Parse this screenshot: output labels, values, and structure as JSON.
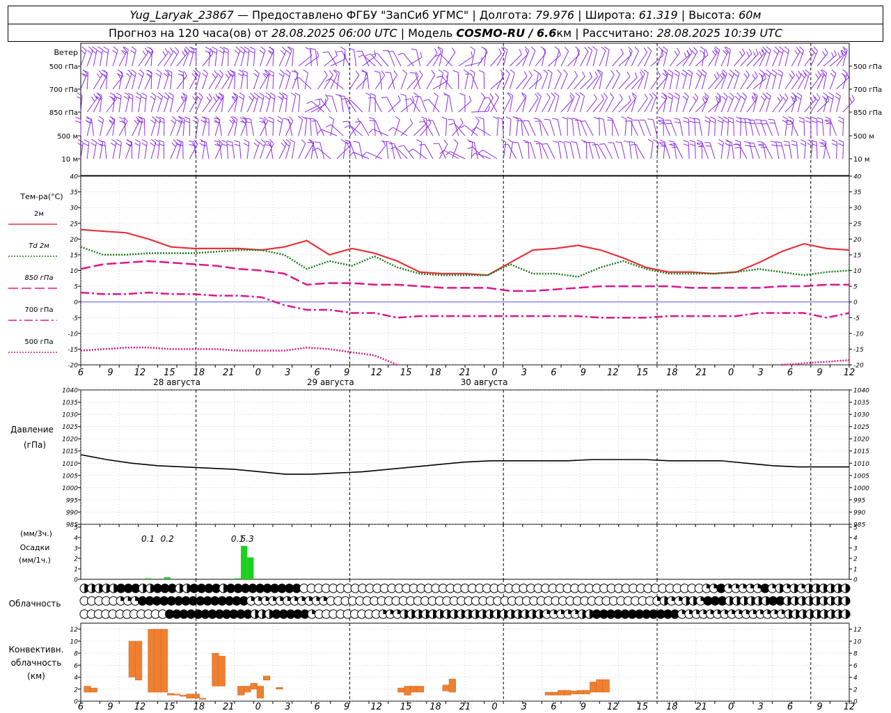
{
  "header": {
    "station": "Yug_Laryak_23867",
    "provider": " — Предоставлено ФГБУ \"ЗапСиб УГМС\" | Долгота: ",
    "lon": "79.976",
    "lat_label": " | Широта: ",
    "lat": "61.319",
    "alt_label": " | Высота: ",
    "alt": "60м",
    "forecast_label": "Прогноз на 120 часа(ов) от ",
    "forecast_time": "28.08.2025 06:00 UTC",
    "model_label": " | Модель ",
    "model": "COSMO-RU / 6.6",
    "model_unit": "км | Рассчитано: ",
    "calc_time": "28.08.2025 10:39 UTC"
  },
  "colors": {
    "wind": "#8a2be2",
    "t2m": "#e8333a",
    "td2m": "#1a7a1a",
    "t850": "#e0148a",
    "t700": "#e0148a",
    "t500": "#e0148a",
    "zero_line": "#3a3aff",
    "precip": "#1ed11e",
    "convective": "#f08030",
    "grid": "#000000"
  },
  "chart_data": [
    {
      "type": "barbs",
      "title": "Ветер",
      "levels": [
        "500 гПа",
        "700 гПа",
        "850 гПа",
        "500 м",
        "10  м"
      ]
    },
    {
      "type": "line",
      "ylabel": "Тем-ра(°C)",
      "ylim": [
        -20,
        40
      ],
      "yticks": [
        40,
        35,
        30,
        25,
        20,
        15,
        10,
        5,
        0,
        -5,
        -10,
        -15,
        -20
      ],
      "x_hours": [
        0,
        3,
        6,
        9,
        12,
        15,
        18,
        21,
        24,
        27,
        30,
        33,
        36,
        39,
        42,
        45,
        48,
        51,
        54,
        57,
        60,
        63,
        66,
        69,
        72,
        75,
        78,
        81,
        84,
        87,
        90,
        93,
        96,
        99,
        102,
        105,
        108,
        111,
        114,
        117,
        120
      ],
      "series": [
        {
          "name": "2м",
          "style": "solid",
          "values": [
            23,
            22.5,
            22,
            20,
            17.5,
            17,
            17,
            17,
            16.5,
            17.5,
            19.5,
            15,
            17,
            15.5,
            13,
            9.5,
            9,
            9,
            8.5,
            12.5,
            16.5,
            17,
            18,
            16.5,
            14,
            11,
            9.5,
            9.5,
            9,
            9.5,
            12.5,
            16,
            18.5,
            17,
            16.5
          ]
        },
        {
          "name": "Td  2м",
          "style": "dotted",
          "values": [
            17.5,
            15,
            15,
            15.5,
            15.5,
            15.5,
            16,
            16.5,
            16.5,
            15,
            10.5,
            13,
            11.5,
            14.5,
            11,
            9,
            8.5,
            8.5,
            8.5,
            12,
            9,
            9,
            8,
            11,
            13,
            10.5,
            9,
            9,
            9,
            9.5,
            10.5,
            9.5,
            8.5,
            9.5,
            10
          ]
        },
        {
          "name": "850 гПа",
          "style": "dashed",
          "values": [
            10.5,
            12,
            12.5,
            13,
            12.5,
            12,
            11.5,
            10.5,
            10,
            9,
            5.5,
            6,
            6,
            5.5,
            5.5,
            5,
            4.5,
            4.5,
            4.5,
            3.5,
            3.5,
            4,
            4.5,
            5,
            5,
            5,
            5,
            4.5,
            4.5,
            4.5,
            4.5,
            5,
            5,
            5.5,
            5.5
          ]
        },
        {
          "name": "700 гПа",
          "style": "dashdot",
          "values": [
            3,
            2.5,
            2.5,
            3,
            2.5,
            2.5,
            2,
            2,
            1.5,
            -1,
            -2.5,
            -2.5,
            -3.5,
            -3.5,
            -5,
            -4.5,
            -4.5,
            -4.5,
            -4.5,
            -4.5,
            -4.5,
            -4.5,
            -4.5,
            -5,
            -5,
            -5,
            -4.5,
            -4.5,
            -4.5,
            -4.5,
            -3.5,
            -3.5,
            -3.5,
            -5,
            -3.5
          ]
        },
        {
          "name": "500 гПа",
          "style": "dotted",
          "values": [
            -15.5,
            -15,
            -14.5,
            -14.5,
            -15,
            -15,
            -15,
            -15.5,
            -15.5,
            -15.5,
            -14.5,
            -15,
            -16,
            -17,
            -20,
            null,
            null,
            null,
            null,
            null,
            null,
            null,
            null,
            null,
            null,
            null,
            null,
            null,
            null,
            null,
            null,
            -20,
            -19.5,
            -19,
            -18.5
          ]
        }
      ],
      "x_labels": [
        "6",
        "9",
        "12",
        "15",
        "18",
        "21",
        "0",
        "3",
        "6",
        "9",
        "12",
        "15",
        "18",
        "21",
        "0",
        "3",
        "6",
        "9",
        "12",
        "15",
        "18",
        "21",
        "0",
        "3",
        "6",
        "9",
        "12"
      ],
      "day_labels": [
        "28 августа",
        "29 августа",
        "30 августа"
      ]
    },
    {
      "type": "line",
      "ylabel": "Давление",
      "yunit": "(гПа)",
      "ylim": [
        985,
        1040
      ],
      "yticks": [
        1040,
        1035,
        1030,
        1025,
        1020,
        1015,
        1010,
        1005,
        1000,
        995,
        990,
        985
      ],
      "series": [
        {
          "name": "pressure",
          "values": [
            1013.5,
            1011.5,
            1010,
            1009,
            1008.5,
            1008,
            1007.5,
            1006.5,
            1005.5,
            1005.5,
            1006,
            1006.5,
            1007.5,
            1008.5,
            1009.5,
            1010.5,
            1011,
            1011,
            1011,
            1011,
            1011.5,
            1011.5,
            1011.5,
            1011,
            1011,
            1011,
            1010,
            1009,
            1008.5,
            1008.5,
            1008.5
          ]
        }
      ]
    },
    {
      "type": "bar",
      "ylabel_top": "(мм/3ч.)",
      "ylabel_mid": "Осадки",
      "ylabel_bot": "(мм/1ч.)",
      "ylim": [
        0,
        5
      ],
      "yticks": [
        5,
        4,
        3,
        2,
        1,
        0
      ],
      "annotations": [
        "0.1",
        "0.2",
        "0.1",
        "5.3"
      ],
      "bars": [
        {
          "hour": 10.5,
          "value": 0.1
        },
        {
          "hour": 13.5,
          "value": 0.2
        },
        {
          "hour": 24.5,
          "value": 0.1
        },
        {
          "hour": 25.5,
          "value": 3.2
        },
        {
          "hour": 26.5,
          "value": 2.1
        }
      ]
    },
    {
      "type": "icons",
      "title": "Облачность",
      "rows": [
        "hhhhhfffhhfffhhffffhffffffffffcccccccccccccccccccccccccccccccccccccccccccccccccccccccqqfqqqqqfqhqhqhhhhhh",
        "cccccqqqfffffffffffffffqqqqqqqqqqqcccccccccccccccccccccccccccccccccccccccccccccqhqqhhqfffhhhhhhffhhhhhhhhh",
        "ccccccccccccffffffffffffhhhfffffqcccccccccqqqhhhhhhhhhhhhhhhhhhhhqqqqqhhffffffffffffqqqqqqqqqqqqqqqhhhhhhhhh"
      ]
    },
    {
      "type": "bar",
      "ylabel": "Конвективн. облачность (км)",
      "ylim": [
        0,
        13
      ],
      "yticks": [
        12,
        10,
        8,
        6,
        4,
        2,
        0
      ],
      "bars": [
        {
          "hour": 1,
          "bottom": 1.5,
          "top": 2.5
        },
        {
          "hour": 2,
          "bottom": 1.5,
          "top": 2.2
        },
        {
          "hour": 8,
          "bottom": 4,
          "top": 10
        },
        {
          "hour": 9,
          "bottom": 3.5,
          "top": 10
        },
        {
          "hour": 11,
          "bottom": 1.5,
          "top": 12
        },
        {
          "hour": 12,
          "bottom": 1.5,
          "top": 12
        },
        {
          "hour": 13,
          "bottom": 1.5,
          "top": 12
        },
        {
          "hour": 14,
          "bottom": 1,
          "top": 1.3
        },
        {
          "hour": 15,
          "bottom": 1,
          "top": 1.2
        },
        {
          "hour": 16,
          "bottom": 0.8,
          "top": 1
        },
        {
          "hour": 17,
          "bottom": 0.5,
          "top": 1.2
        },
        {
          "hour": 18,
          "bottom": 0.5,
          "top": 1.2
        },
        {
          "hour": 19,
          "bottom": 0.3,
          "top": 0.5
        },
        {
          "hour": 21,
          "bottom": 2.5,
          "top": 8
        },
        {
          "hour": 22,
          "bottom": 2.5,
          "top": 7.5
        },
        {
          "hour": 25,
          "bottom": 1,
          "top": 2.5
        },
        {
          "hour": 26,
          "bottom": 1.5,
          "top": 2.5
        },
        {
          "hour": 27,
          "bottom": 2,
          "top": 3
        },
        {
          "hour": 28,
          "bottom": 0.5,
          "top": 2.5
        },
        {
          "hour": 29,
          "bottom": 3.5,
          "top": 4.2
        },
        {
          "hour": 31,
          "bottom": 2,
          "top": 2.3
        },
        {
          "hour": 50,
          "bottom": 1.5,
          "top": 2.2
        },
        {
          "hour": 51,
          "bottom": 1,
          "top": 2.5
        },
        {
          "hour": 52,
          "bottom": 1.5,
          "top": 2.5
        },
        {
          "hour": 53,
          "bottom": 1.5,
          "top": 2.5
        },
        {
          "hour": 57,
          "bottom": 1.7,
          "top": 2.7
        },
        {
          "hour": 58,
          "bottom": 1.5,
          "top": 3.7
        },
        {
          "hour": 73,
          "bottom": 1,
          "top": 1.5
        },
        {
          "hour": 74,
          "bottom": 1,
          "top": 1.5
        },
        {
          "hour": 75,
          "bottom": 1,
          "top": 1.8
        },
        {
          "hour": 76,
          "bottom": 1,
          "top": 1.8
        },
        {
          "hour": 77,
          "bottom": 1.2,
          "top": 1.7
        },
        {
          "hour": 78,
          "bottom": 1.2,
          "top": 1.8
        },
        {
          "hour": 79,
          "bottom": 1.2,
          "top": 1.8
        },
        {
          "hour": 80,
          "bottom": 1.5,
          "top": 3.2
        },
        {
          "hour": 81,
          "bottom": 1.5,
          "top": 3.6
        },
        {
          "hour": 82,
          "bottom": 1.5,
          "top": 3.6
        }
      ],
      "x_labels": [
        "6",
        "9",
        "12",
        "15",
        "18",
        "21",
        "0",
        "3",
        "6",
        "9",
        "12",
        "15",
        "18",
        "21",
        "0",
        "3",
        "6",
        "9",
        "12",
        "15",
        "18",
        "21",
        "0",
        "3",
        "6",
        "9",
        "12"
      ]
    }
  ]
}
